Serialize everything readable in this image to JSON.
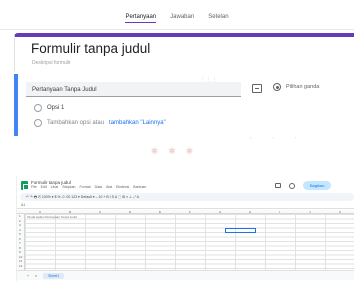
{
  "forms": {
    "tabs": [
      "Pertanyaan",
      "Jawaban",
      "Setelan"
    ],
    "title": "Formulir tanpa judul",
    "description": "Deskripsi formulir",
    "question": {
      "title": "Pertanyaan Tanpa Judul",
      "type_label": "Pilihan ganda",
      "option1": "Opsi 1",
      "add_option": "Tambahkan opsi atau",
      "add_other": "tambahkan \"Lainnya\""
    },
    "accent_color": "#673ab7",
    "active_card_color": "#4285f4"
  },
  "sheets": {
    "doc_title": "Formulir tanpa judul",
    "menu": [
      "File",
      "Edit",
      "Lihat",
      "Sisipkan",
      "Format",
      "Data",
      "Alat",
      "Ekstensi",
      "Bantuan"
    ],
    "share_label": "Bagikan",
    "toolbar_text": "↶ ↷ 🖶 ⎘ 100% ▾  $ % .0 .00 123 ▾  Default ▾  – 10 +  B I S A  ⬚ ⊞ ≡ ⊥ ⤢ A",
    "name_box": "A1",
    "columns": [
      "A",
      "B",
      "C",
      "D",
      "E",
      "F",
      "G",
      "H",
      "I",
      "J",
      "K"
    ],
    "rows": [
      "1",
      "2",
      "3",
      "4",
      "5",
      "6",
      "7",
      "8",
      "9",
      "10",
      "11",
      "12"
    ],
    "a1_text": "Tanda waktu   Pertanyaan Tanpa Judul",
    "sheet_tab": "Sheet1",
    "accent_color": "#0f9d58"
  }
}
